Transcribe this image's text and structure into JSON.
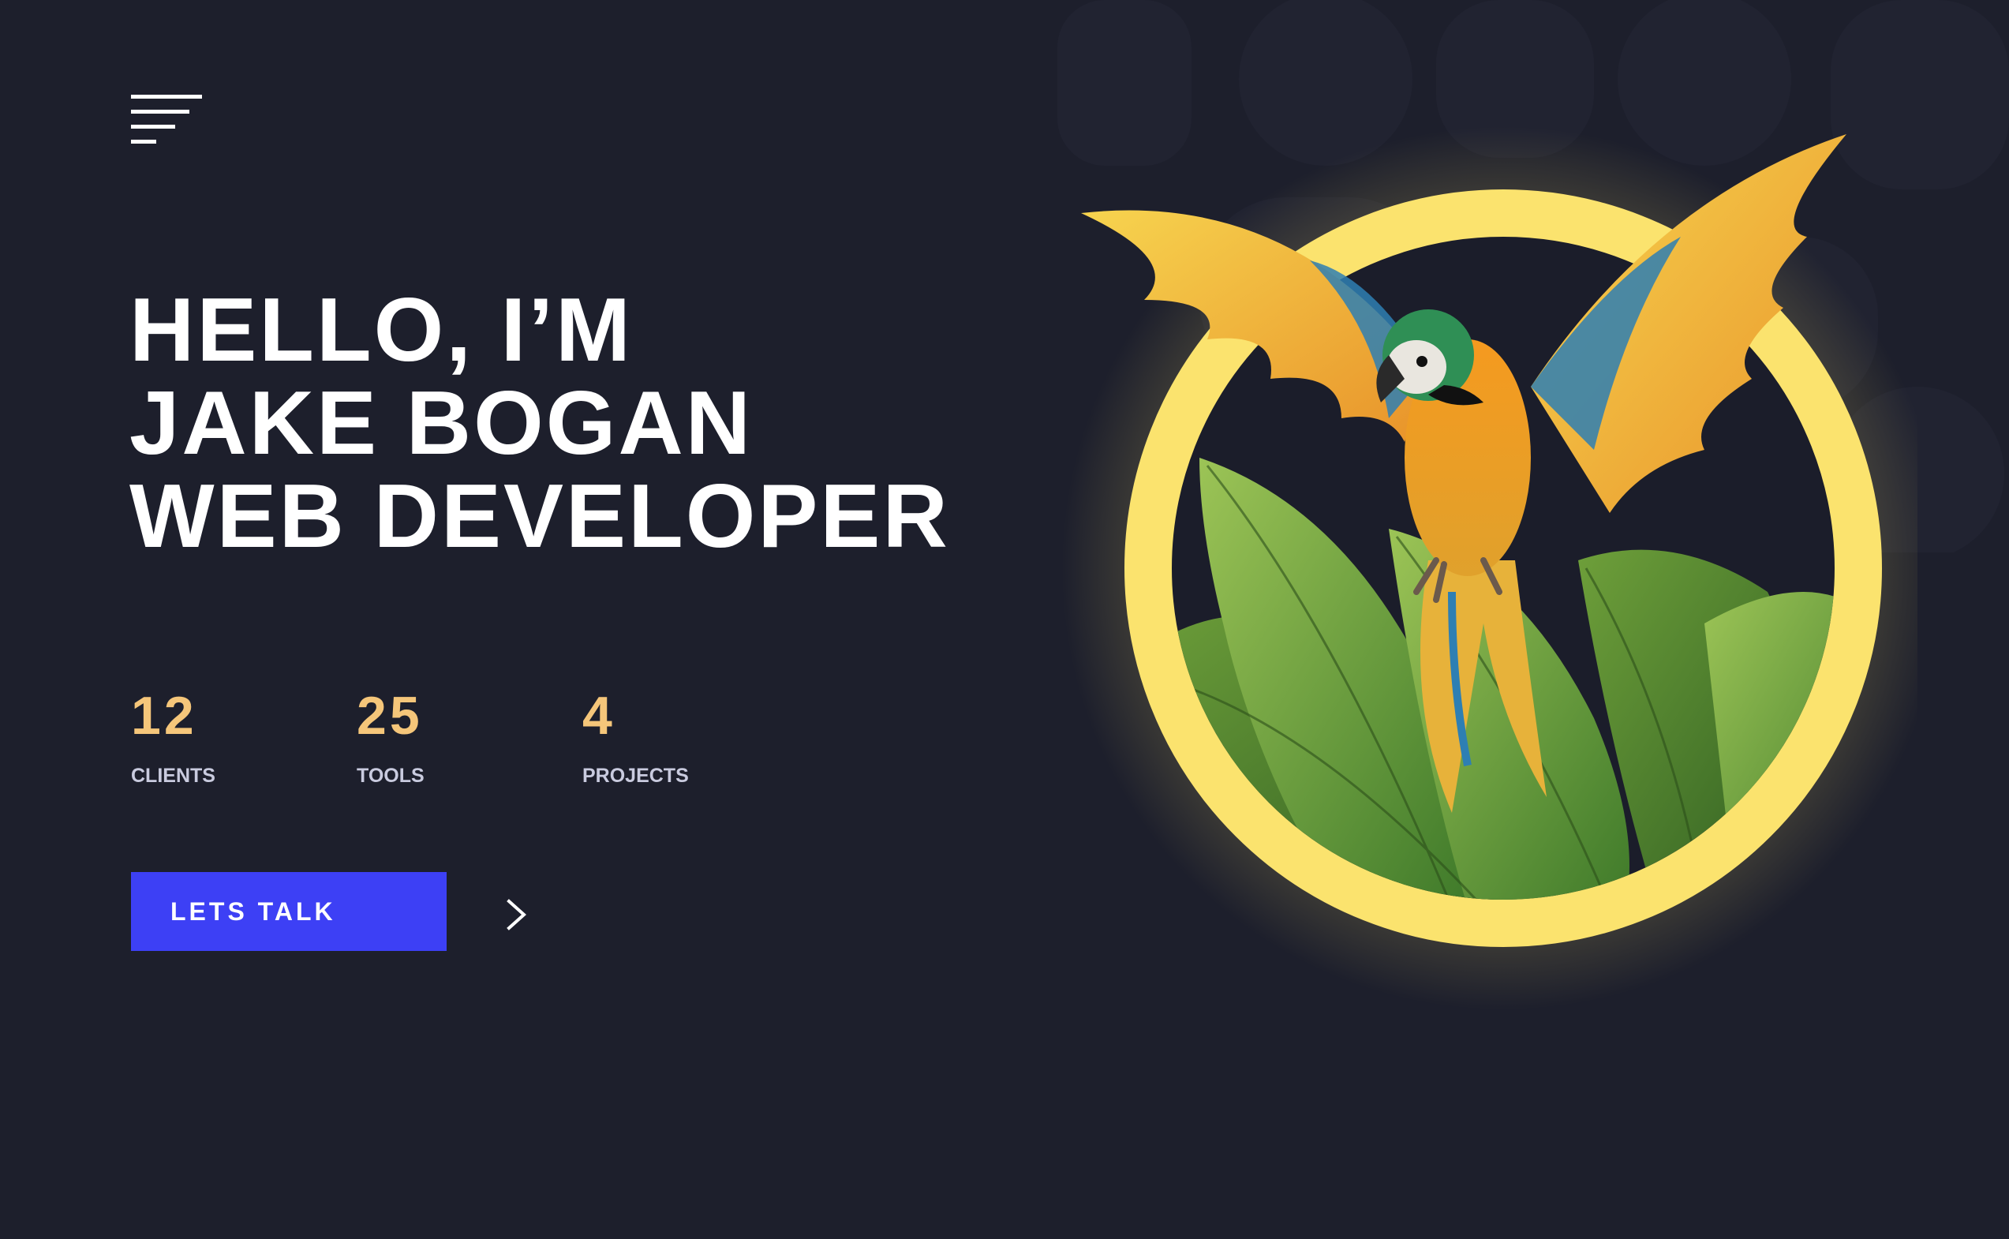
{
  "hero": {
    "line1": "HELLO, I’M",
    "line2": "JAKE BOGAN",
    "line3": "WEB DEVELOPER"
  },
  "stats": [
    {
      "value": "12",
      "label": "CLIENTS"
    },
    {
      "value": "25",
      "label": "TOOLS"
    },
    {
      "value": "4",
      "label": "PROJECTS"
    }
  ],
  "cta": {
    "label": "LETS TALK"
  },
  "icons": {
    "menu": "hamburger-menu-icon",
    "cta_arrow": "chevron-right-icon"
  },
  "colors": {
    "background": "#1d1f2c",
    "accent": "#3d40f5",
    "stat_number": "#f5c67a",
    "ring": "#fbe36e"
  }
}
